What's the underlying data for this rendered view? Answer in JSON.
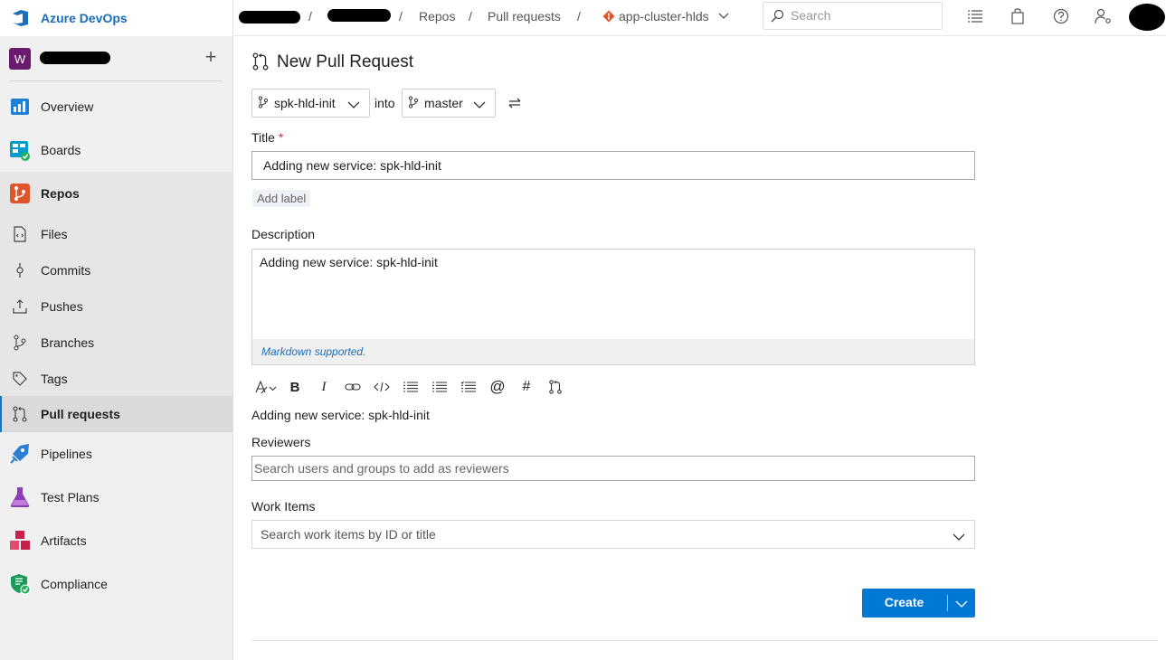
{
  "app": {
    "name": "Azure DevOps"
  },
  "project": {
    "initial": "W"
  },
  "sidebar": {
    "items": [
      {
        "label": "Overview",
        "icon": "overview-icon"
      },
      {
        "label": "Boards",
        "icon": "boards-icon"
      },
      {
        "label": "Repos",
        "icon": "repos-icon"
      },
      {
        "label": "Files",
        "icon": "files-icon"
      },
      {
        "label": "Commits",
        "icon": "commits-icon"
      },
      {
        "label": "Pushes",
        "icon": "pushes-icon"
      },
      {
        "label": "Branches",
        "icon": "branches-icon"
      },
      {
        "label": "Tags",
        "icon": "tags-icon"
      },
      {
        "label": "Pull requests",
        "icon": "pull-requests-icon"
      },
      {
        "label": "Pipelines",
        "icon": "pipelines-icon"
      },
      {
        "label": "Test Plans",
        "icon": "test-plans-icon"
      },
      {
        "label": "Artifacts",
        "icon": "artifacts-icon"
      },
      {
        "label": "Compliance",
        "icon": "compliance-icon"
      }
    ]
  },
  "breadcrumb": {
    "separator": "/",
    "repos": "Repos",
    "pull_requests": "Pull requests",
    "repo": "app-cluster-hlds"
  },
  "search": {
    "placeholder": "Search"
  },
  "page": {
    "title": "New Pull Request",
    "source_branch": "spk-hld-init",
    "into_label": "into",
    "target_branch": "master"
  },
  "form": {
    "title_label": "Title",
    "title_required": "*",
    "title_value": "Adding new service: spk-hld-init",
    "add_label": "Add label",
    "description_label": "Description",
    "description_value": "Adding new service: spk-hld-init",
    "markdown_note": "Markdown supported.",
    "preview_text": "Adding new service: spk-hld-init",
    "reviewers_label": "Reviewers",
    "reviewers_placeholder": "Search users and groups to add as reviewers",
    "work_items_label": "Work Items",
    "work_items_placeholder": "Search work items by ID or title",
    "create_label": "Create"
  },
  "toolbar": {
    "bold": "B",
    "italic": "I",
    "mention": "@",
    "hash": "#"
  },
  "colors": {
    "accent": "#0078d4",
    "brand_text": "#1a6fb8",
    "project_avatar": "#6a1b6e",
    "required": "#c4314b"
  }
}
